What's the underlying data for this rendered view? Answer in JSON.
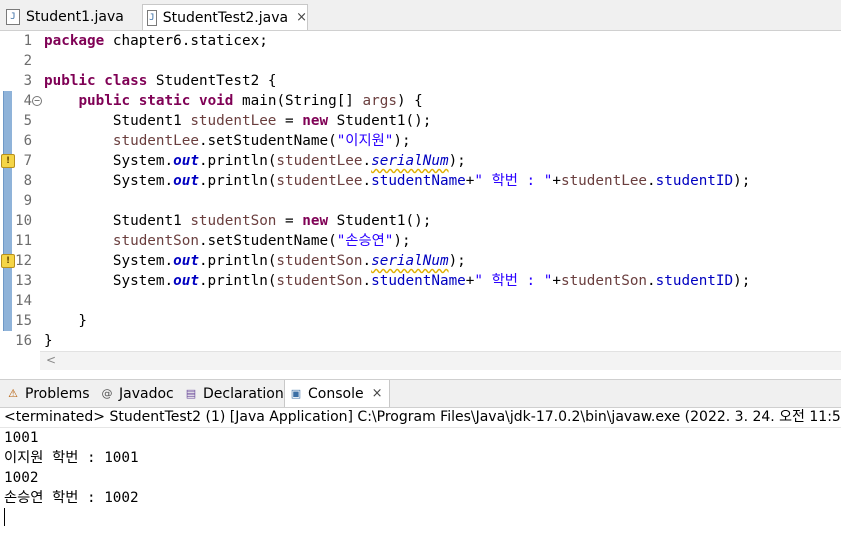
{
  "tabs": [
    {
      "label": "Student1.java",
      "active": false
    },
    {
      "label": "StudentTest2.java",
      "active": true
    }
  ],
  "close_glyph": "×",
  "file_icon_glyph": "J",
  "line_numbers": [
    "1",
    "2",
    "3",
    "4",
    "5",
    "6",
    "7",
    "8",
    "9",
    "10",
    "11",
    "12",
    "13",
    "14",
    "15",
    "16"
  ],
  "code": {
    "l1_kw": "package",
    "l1_rest": " chapter6.staticex;",
    "l3_kw1": "public",
    "l3_kw2": "class",
    "l3_rest": " StudentTest2 {",
    "l4_indent": "    ",
    "l4_kw1": "public",
    "l4_kw2": "static",
    "l4_kw3": "void",
    "l4_rest1": " main(String[] ",
    "l4_args": "args",
    "l4_rest2": ") {",
    "l5_a": "        Student1 ",
    "l5_var": "studentLee",
    "l5_b": " = ",
    "l5_kw": "new",
    "l5_c": " Student1();",
    "l6_indent": "        ",
    "l6_var": "studentLee",
    "l6_b": ".setStudentName(",
    "l6_str": "\"이지원\"",
    "l6_c": ");",
    "l7_a": "        System.",
    "l7_out": "out",
    "l7_b": ".println(",
    "l7_var": "studentLee",
    "l7_dot": ".",
    "l7_field": "serialNum",
    "l7_c": ");",
    "l8_a": "        System.",
    "l8_out": "out",
    "l8_b": ".println(",
    "l8_var": "studentLee",
    "l8_dot": ".",
    "l8_field1": "studentName",
    "l8_plus": "+",
    "l8_str": "\" 학번 : \"",
    "l8_plus2": "+",
    "l8_var2": "studentLee",
    "l8_dot2": ".",
    "l8_field2": "studentID",
    "l8_c": ");",
    "l10_a": "        Student1 ",
    "l10_var": "studentSon",
    "l10_b": " = ",
    "l10_kw": "new",
    "l10_c": " Student1();",
    "l11_indent": "        ",
    "l11_var": "studentSon",
    "l11_b": ".setStudentName(",
    "l11_str": "\"손승연\"",
    "l11_c": ");",
    "l12_a": "        System.",
    "l12_out": "out",
    "l12_b": ".println(",
    "l12_var": "studentSon",
    "l12_dot": ".",
    "l12_field": "serialNum",
    "l12_c": ");",
    "l13_a": "        System.",
    "l13_out": "out",
    "l13_b": ".println(",
    "l13_var": "studentSon",
    "l13_dot": ".",
    "l13_field1": "studentName",
    "l13_plus": "+",
    "l13_str": "\" 학번 : \"",
    "l13_plus2": "+",
    "l13_var2": "studentSon",
    "l13_dot2": ".",
    "l13_field2": "studentID",
    "l13_c": ");",
    "l15": "    }",
    "l16": "}"
  },
  "scroll_left_glyph": "<",
  "view_tabs": [
    {
      "label": "Problems",
      "icon": "problems-icon",
      "glyph": "⚠"
    },
    {
      "label": "Javadoc",
      "icon": "javadoc-icon",
      "glyph": "@"
    },
    {
      "label": "Declaration",
      "icon": "declaration-icon",
      "glyph": "▤"
    },
    {
      "label": "Console",
      "icon": "console-icon",
      "glyph": "▣",
      "active": true
    }
  ],
  "console": {
    "header": "<terminated> StudentTest2 (1) [Java Application] C:\\Program Files\\Java\\jdk-17.0.2\\bin\\javaw.exe  (2022. 3. 24. 오전 11:5",
    "lines": [
      "1001",
      "이지원 학번 : 1001",
      "1002",
      "손승연 학번 : 1002"
    ]
  },
  "colors": {
    "keyword": "#7f0055",
    "field": "#0000c0",
    "string": "#2a00ff",
    "local_var": "#6a3e3e"
  }
}
